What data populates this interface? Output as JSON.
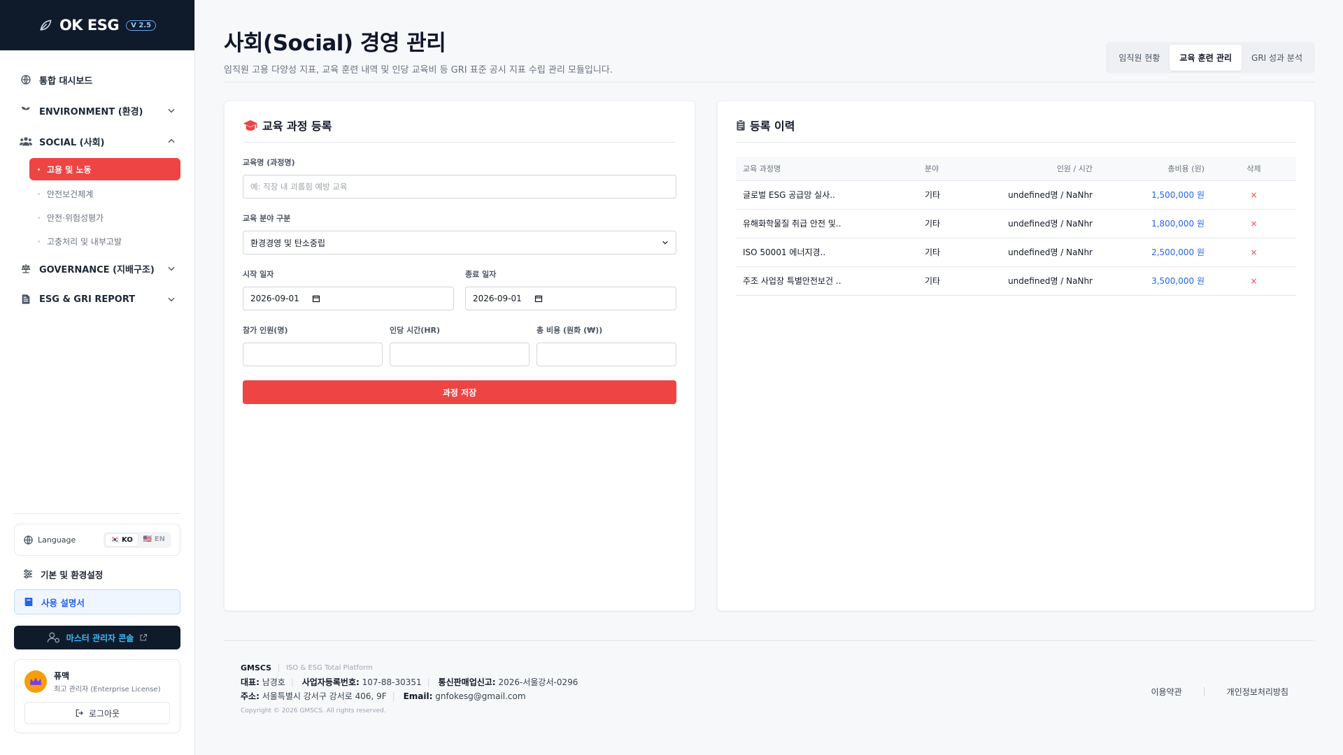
{
  "brand": {
    "name": "OK ESG",
    "version": "V 2.5"
  },
  "sidebar": {
    "items": [
      {
        "label": "통합 대시보드",
        "icon": "globe-icon"
      },
      {
        "label": "ENVIRONMENT (환경)",
        "icon": "sprout-icon"
      },
      {
        "label": "SOCIAL (사회)",
        "icon": "users-icon"
      },
      {
        "label": "GOVERNANCE (지배구조)",
        "icon": "scale-icon"
      },
      {
        "label": "ESG & GRI REPORT",
        "icon": "report-icon"
      }
    ],
    "social_sub": [
      "고용 및 노동",
      "안전보건체계",
      "안전·위험성평가",
      "고충처리 및 내부고발"
    ],
    "language_label": "Language",
    "lang_ko": "🇰🇷 KO",
    "lang_en": "🇺🇸 EN",
    "settings_label": "기본 및 환경설정",
    "manual_label": "사용 설명서",
    "master_label": "마스터 관리자 콘솔",
    "user_name": "퓨맥",
    "user_role": "최고 관리자 (Enterprise License)",
    "logout_label": "로그아웃"
  },
  "header": {
    "title": "사회(Social) 경영 관리",
    "description": "임직원 고용 다양성 지표, 교육 훈련 내역 및 인당 교육비 등 GRI 표준 공시 지표 수립 관리 모듈입니다.",
    "tabs": [
      "임직원 현황",
      "교육 훈련 관리",
      "GRI 성과 분석"
    ],
    "active_tab": "교육 훈련 관리"
  },
  "form": {
    "title": "교육 과정 등록",
    "course_label": "교육명 (과정명)",
    "course_placeholder": "예: 직장 내 괴롭힘 예방 교육",
    "category_label": "교육 분야 구분",
    "category_value": "환경경영 및 탄소중립",
    "start_label": "시작 일자",
    "start_value": "2026-09-01",
    "end_label": "종료 일자",
    "end_value": "2026-09-01",
    "participants_label": "참가 인원(명)",
    "hours_label": "인당 시간(HR)",
    "cost_label": "총 비용 (원화 (₩))",
    "save_label": "과정 저장"
  },
  "history": {
    "title": "등록 이력",
    "columns": [
      "교육 과정명",
      "분야",
      "인원 / 시간",
      "총비용 (원)",
      "삭제"
    ],
    "rows": [
      {
        "name": "글로벌 ESG 공급망 실사..",
        "category": "기타",
        "people_hours": "undefined명 / NaNhr",
        "cost": "1,500,000 원",
        "del": "×"
      },
      {
        "name": "유해화학물질 취급 안전 및..",
        "category": "기타",
        "people_hours": "undefined명 / NaNhr",
        "cost": "1,800,000 원",
        "del": "×"
      },
      {
        "name": "ISO 50001 에너지경..",
        "category": "기타",
        "people_hours": "undefined명 / NaNhr",
        "cost": "2,500,000 원",
        "del": "×"
      },
      {
        "name": "주조 사업장 특별안전보건 ..",
        "category": "기타",
        "people_hours": "undefined명 / NaNhr",
        "cost": "3,500,000 원",
        "del": "×"
      }
    ]
  },
  "footer": {
    "company": "GMSCS",
    "platform": "ISO & ESG Total Platform",
    "ceo_label": "대표:",
    "ceo": "남경호",
    "biz_label": "사업자등록번호:",
    "biz": "107-88-30351",
    "ecom_label": "통신판매업신고:",
    "ecom": "2026-서울강서-0296",
    "addr_label": "주소:",
    "addr": "서울특별시 강서구 강서로 406, 9F",
    "email_label": "Email:",
    "email": "gnfokesg@gmail.com",
    "copyright": "Copyright © 2026 GMSCS. All rights reserved.",
    "terms": "이용약관",
    "privacy": "개인정보처리방침"
  },
  "colors": {
    "accent": "#ef4444",
    "navy": "#0f1a2b",
    "link": "#2563eb"
  }
}
